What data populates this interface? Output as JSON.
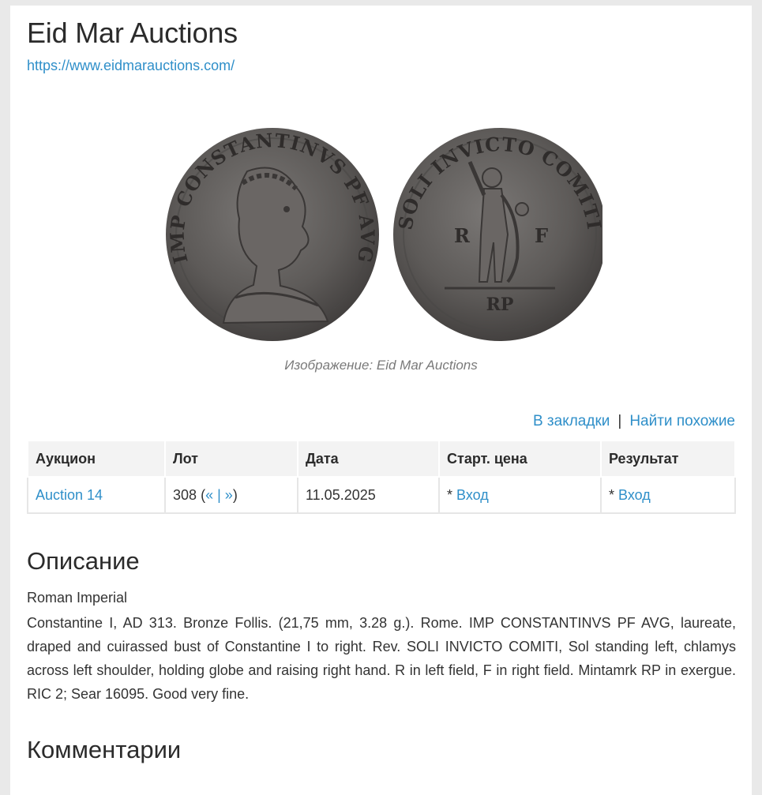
{
  "lot": {
    "title": "Eid Mar Auctions",
    "url": "https://www.eidmarauctions.com/",
    "image_caption": "Изображение: Eid Mar Auctions",
    "coin_obverse_legend": "IMP CONSTANTINVS PF AVG",
    "coin_reverse_legend": "SOLI INVICTO COMITI",
    "coin_reverse_field_left": "R",
    "coin_reverse_field_right": "F",
    "coin_reverse_exergue": "RP"
  },
  "actions": {
    "bookmark": "В закладки",
    "separator": "|",
    "find_similar": "Найти похожие"
  },
  "table": {
    "headers": [
      "Аукцион",
      "Лот",
      "Дата",
      "Старт. цена",
      "Результат"
    ],
    "row": {
      "auction": "Auction 14",
      "lot_number": "308",
      "lot_open": "(",
      "prev": "«",
      "mid": "|",
      "next": "»",
      "lot_close": ")",
      "date": "11.05.2025",
      "start_prefix": "*",
      "start_link": "Вход",
      "result_prefix": "*",
      "result_link": "Вход"
    }
  },
  "description": {
    "heading": "Описание",
    "subtitle": "Roman Imperial",
    "text": "Constantine I, AD 313. Bronze Follis. (21,75 mm, 3.28 g.). Rome. IMP CONSTANTINVS PF AVG, laureate, draped and cuirassed bust of Constantine I to right. Rev. SOLI INVICTO COMITI, Sol standing left, chlamys across left shoulder, holding globe and raising right hand. R in left field, F in right field. Mintamrk RP in exergue. RIC 2; Sear 16095. Good very fine."
  },
  "comments": {
    "heading": "Комментарии"
  },
  "colors": {
    "link": "#2f8fc9",
    "coin_metal": "#5d5a58",
    "page_bg": "#e9e9e9"
  }
}
